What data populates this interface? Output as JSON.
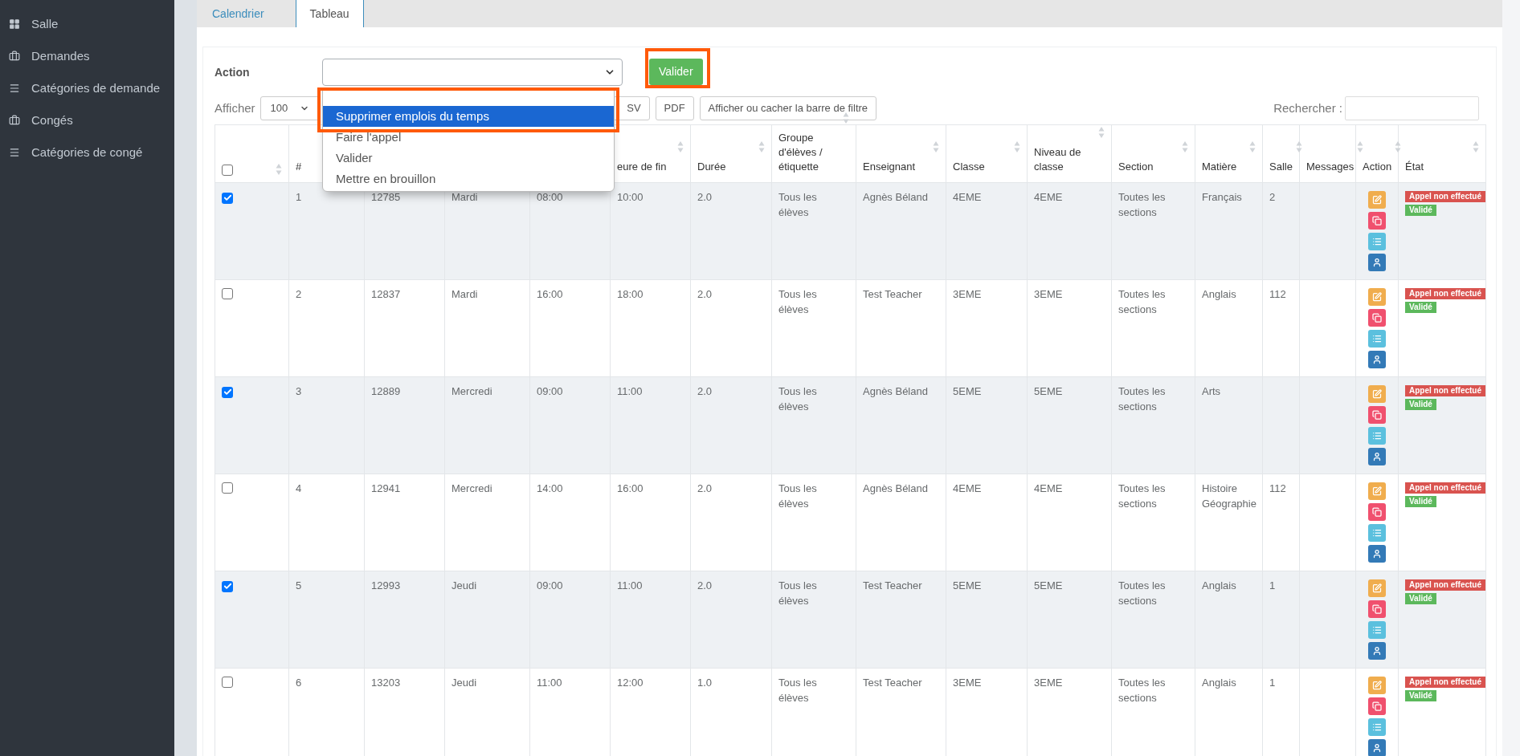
{
  "sidebar": {
    "items": [
      {
        "label": "Salle",
        "kind": "grid"
      },
      {
        "label": "Demandes",
        "kind": "briefcase"
      },
      {
        "label": "Catégories de demande",
        "kind": "menu"
      },
      {
        "label": "Congés",
        "kind": "briefcase"
      },
      {
        "label": "Catégories de congé",
        "kind": "menu"
      }
    ]
  },
  "tabs": [
    {
      "label": "Calendrier",
      "selected": false
    },
    {
      "label": "Tableau",
      "selected": true
    }
  ],
  "action_form": {
    "label": "Action",
    "submit": {
      "label": "Valider",
      "highlighted": true
    },
    "dropdown": {
      "expanded": true,
      "highlighted": true,
      "options": [
        {
          "label": "Supprimer emplois du temps",
          "selected": true
        },
        {
          "label": "Faire l'appel",
          "selected": false
        },
        {
          "label": "Valider",
          "selected": false
        },
        {
          "label": "Mettre en brouillon",
          "selected": false
        }
      ]
    }
  },
  "toolbar": {
    "show_label": "Afficher",
    "page_size": "100",
    "buttons": [
      "SV",
      "PDF",
      "Afficher ou cacher la barre de filtre"
    ],
    "search_label": "Rechercher :"
  },
  "table": {
    "select_all_checked": false,
    "columns": [
      {
        "label": "#",
        "sortable": false
      },
      {},
      {},
      {},
      {
        "label": "eure de fin",
        "sortable": true
      },
      {
        "label": "Durée",
        "sortable": true
      },
      {
        "label": "Groupe d'élèves / étiquette",
        "sortable": true
      },
      {
        "label": "Enseignant",
        "sortable": true
      },
      {
        "label": "Classe",
        "sortable": true
      },
      {
        "label": "Niveau de classe",
        "sortable": true
      },
      {
        "label": "Section",
        "sortable": true
      },
      {
        "label": "Matière",
        "sortable": true
      },
      {
        "label": "Salle",
        "sortable": true
      },
      {
        "label": "Messages",
        "sortable": true
      },
      {
        "label": "Action",
        "sortable": true
      },
      {
        "label": "État",
        "sortable": true
      }
    ],
    "rows": [
      {
        "checked": true,
        "cells": [
          "1",
          "12785",
          "Mardi",
          "08:00",
          "10:00",
          "2.0",
          "Tous les élèves",
          "Agnès Béland",
          "4EME",
          "4EME",
          "Toutes les sections",
          "Français",
          "2",
          null
        ],
        "actions": [
          {
            "kind": "edit"
          },
          {
            "kind": "copy"
          },
          {
            "kind": "list"
          },
          {
            "kind": "user"
          }
        ],
        "badges": [
          {
            "label": "Appel non effectué",
            "kind": "danger"
          },
          {
            "label": "Validé",
            "kind": "success"
          }
        ]
      },
      {
        "checked": false,
        "cells": [
          "2",
          "12837",
          "Mardi",
          "16:00",
          "18:00",
          "2.0",
          "Tous les élèves",
          "Test Teacher",
          "3EME",
          "3EME",
          "Toutes les sections",
          "Anglais",
          "112",
          null
        ],
        "actions": [
          {
            "kind": "edit"
          },
          {
            "kind": "copy"
          },
          {
            "kind": "list"
          },
          {
            "kind": "user"
          }
        ],
        "badges": [
          {
            "label": "Appel non effectué",
            "kind": "danger"
          },
          {
            "label": "Validé",
            "kind": "success"
          }
        ]
      },
      {
        "checked": true,
        "cells": [
          "3",
          "12889",
          "Mercredi",
          "09:00",
          "11:00",
          "2.0",
          "Tous les élèves",
          "Agnès Béland",
          "5EME",
          "5EME",
          "Toutes les sections",
          "Arts",
          null,
          null
        ],
        "actions": [
          {
            "kind": "edit"
          },
          {
            "kind": "copy"
          },
          {
            "kind": "list"
          },
          {
            "kind": "user"
          }
        ],
        "badges": [
          {
            "label": "Appel non effectué",
            "kind": "danger"
          },
          {
            "label": "Validé",
            "kind": "success"
          }
        ]
      },
      {
        "checked": false,
        "cells": [
          "4",
          "12941",
          "Mercredi",
          "14:00",
          "16:00",
          "2.0",
          "Tous les élèves",
          "Agnès Béland",
          "4EME",
          "4EME",
          "Toutes les sections",
          "Histoire Géographie",
          "112",
          null
        ],
        "actions": [
          {
            "kind": "edit"
          },
          {
            "kind": "copy"
          },
          {
            "kind": "list"
          },
          {
            "kind": "user"
          }
        ],
        "badges": [
          {
            "label": "Appel non effectué",
            "kind": "danger"
          },
          {
            "label": "Validé",
            "kind": "success"
          }
        ]
      },
      {
        "checked": true,
        "cells": [
          "5",
          "12993",
          "Jeudi",
          "09:00",
          "11:00",
          "2.0",
          "Tous les élèves",
          "Test Teacher",
          "5EME",
          "5EME",
          "Toutes les sections",
          "Anglais",
          "1",
          null
        ],
        "actions": [
          {
            "kind": "edit"
          },
          {
            "kind": "copy"
          },
          {
            "kind": "list"
          },
          {
            "kind": "user"
          }
        ],
        "badges": [
          {
            "label": "Appel non effectué",
            "kind": "danger"
          },
          {
            "label": "Validé",
            "kind": "success"
          }
        ]
      },
      {
        "checked": false,
        "cells": [
          "6",
          "13203",
          "Jeudi",
          "11:00",
          "12:00",
          "1.0",
          "Tous les élèves",
          "Test Teacher",
          "3EME",
          "3EME",
          "Toutes les sections",
          "Anglais",
          "1",
          null
        ],
        "actions": [
          {
            "kind": "edit"
          },
          {
            "kind": "copy"
          },
          {
            "kind": "list"
          },
          {
            "kind": "user"
          }
        ],
        "badges": [
          {
            "label": "Appel non effectué",
            "kind": "danger"
          },
          {
            "label": "Validé",
            "kind": "success"
          }
        ]
      }
    ]
  }
}
